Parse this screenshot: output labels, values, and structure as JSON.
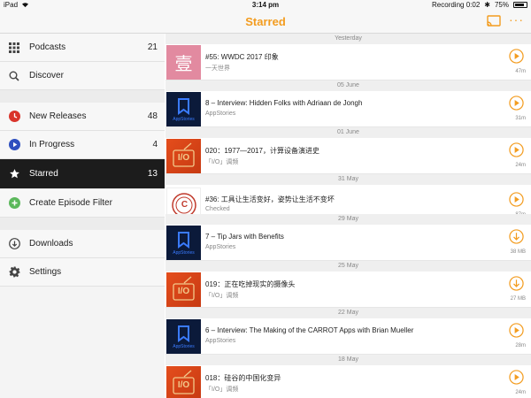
{
  "status": {
    "carrier": "iPad",
    "time": "3:14 pm",
    "recording": "Recording 0:02",
    "battery": "75%"
  },
  "nav": {
    "title": "Starred",
    "more": "···"
  },
  "sidebar": {
    "items": [
      {
        "label": "Podcasts",
        "count": "21",
        "icon": "grid-icon"
      },
      {
        "label": "Discover",
        "count": "",
        "icon": "search-icon"
      },
      {
        "label": "New Releases",
        "count": "48",
        "icon": "clock-icon"
      },
      {
        "label": "In Progress",
        "count": "4",
        "icon": "play-icon"
      },
      {
        "label": "Starred",
        "count": "13",
        "icon": "star-icon"
      },
      {
        "label": "Create Episode Filter",
        "count": "",
        "icon": "plus-icon"
      },
      {
        "label": "Downloads",
        "count": "",
        "icon": "download-icon"
      },
      {
        "label": "Settings",
        "count": "",
        "icon": "gear-icon"
      }
    ]
  },
  "episodes": {
    "groups": [
      {
        "date": "Yesterday"
      },
      {
        "date": "05 June"
      },
      {
        "date": "01 June"
      },
      {
        "date": "31 May"
      },
      {
        "date": "29 May"
      },
      {
        "date": "25 May"
      },
      {
        "date": "22 May"
      },
      {
        "date": "18 May"
      }
    ],
    "items": [
      {
        "title": "#55: WWDC 2017 印象",
        "podcast": "一天世界",
        "meta": "47m",
        "action": "play",
        "art": "壹"
      },
      {
        "title": "8 – Interview: Hidden Folks with Adriaan de Jongh",
        "podcast": "AppStories",
        "meta": "31m",
        "action": "play",
        "art": "AppStories"
      },
      {
        "title": "020：1977—2017，计算设备演进史",
        "podcast": "「I/O」调频",
        "meta": "24m",
        "action": "play",
        "art": "I/O"
      },
      {
        "title": "#36: 工具让生活变好，姿势让生活不变坏",
        "podcast": "Checked",
        "meta": "87m",
        "action": "play",
        "art": "C"
      },
      {
        "title": "7 – Tip Jars with Benefits",
        "podcast": "AppStories",
        "meta": "38 MB",
        "action": "download",
        "art": "AppStories"
      },
      {
        "title": "019：正在吃掉现实的摄像头",
        "podcast": "「I/O」调频",
        "meta": "27 MB",
        "action": "download",
        "art": "I/O"
      },
      {
        "title": "6 – Interview: The Making of the CARROT Apps with Brian Mueller",
        "podcast": "AppStories",
        "meta": "28m",
        "action": "play",
        "art": "AppStories"
      },
      {
        "title": "018：硅谷的中国化变异",
        "podcast": "「I/O」调频",
        "meta": "24m",
        "action": "play",
        "art": "I/O"
      }
    ]
  },
  "colors": {
    "accent": "#f39c1f",
    "new_releases": "#d9342b",
    "in_progress": "#2e4fbf",
    "create_filter": "#5cb85c"
  }
}
